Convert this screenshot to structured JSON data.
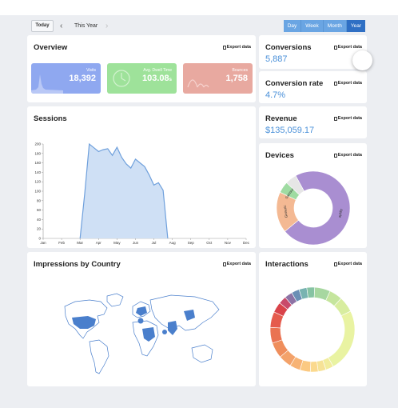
{
  "toolbar": {
    "today_label": "Today",
    "prev_icon": "chevron-left-icon",
    "period_label": "This Year",
    "next_icon": "chevron-right-icon",
    "range_options": [
      "Day",
      "Week",
      "Month",
      "Year"
    ],
    "active_range": "Year"
  },
  "export_label": "Export data",
  "overview": {
    "title": "Overview",
    "tiles": [
      {
        "label": "Visits",
        "value": "18,392",
        "color": "#8fa8f0",
        "icon": "area-sparkline-icon"
      },
      {
        "label": "Avg. Dwell Time",
        "value": "103.08",
        "suffix": "s",
        "color": "#9ee29a",
        "icon": "clock-icon"
      },
      {
        "label": "Bounces",
        "value": "1,758",
        "color": "#e8a9a0",
        "icon": "bounce-arc-icon"
      }
    ]
  },
  "conversions": {
    "title": "Conversions",
    "value": "5,887"
  },
  "conversion_rate": {
    "title": "Conversion rate",
    "value": "4.7%"
  },
  "revenue": {
    "title": "Revenue",
    "value": "$135,059.17"
  },
  "sessions": {
    "title": "Sessions"
  },
  "devices": {
    "title": "Devices"
  },
  "impressions": {
    "title": "Impressions by Country"
  },
  "interactions": {
    "title": "Interactions"
  },
  "chart_data": [
    {
      "type": "area",
      "title": "Sessions",
      "categories": [
        "Jan",
        "Feb",
        "Mar",
        "Apr",
        "May",
        "Jun",
        "Jul",
        "Aug",
        "Sep",
        "Oct",
        "Nov",
        "Dec"
      ],
      "x": [
        2.0,
        2.25,
        2.5,
        2.75,
        3.0,
        3.25,
        3.5,
        3.75,
        4.0,
        4.25,
        4.5,
        4.75,
        5.0,
        5.25,
        5.5,
        5.75,
        6.0,
        6.25,
        6.5,
        6.75
      ],
      "values": [
        0,
        95,
        200,
        192,
        184,
        188,
        190,
        176,
        193,
        172,
        158,
        149,
        168,
        160,
        152,
        134,
        113,
        118,
        102,
        0
      ],
      "ylim": [
        0,
        200
      ],
      "yticks": [
        0,
        20,
        40,
        60,
        80,
        100,
        120,
        140,
        160,
        180,
        200
      ],
      "color": "#6fa0dc",
      "fill": "#cfe0f5"
    },
    {
      "type": "pie",
      "title": "Devices",
      "donut": true,
      "series": [
        {
          "name": "Apple",
          "value": 72,
          "color": "#a98ed1"
        },
        {
          "name": "Generic",
          "value": 18,
          "color": "#f4b993"
        },
        {
          "name": "Samsung",
          "value": 5,
          "color": "#9fdba2"
        },
        {
          "name": "",
          "value": 5,
          "color": "#e6e6e6"
        }
      ]
    },
    {
      "type": "pie",
      "title": "Interactions",
      "donut": true,
      "series": [
        {
          "name": "",
          "value": 24,
          "color": "#e9f3a2"
        },
        {
          "name": "",
          "value": 3,
          "color": "#f2ec9c"
        },
        {
          "name": "",
          "value": 3,
          "color": "#f6e296"
        },
        {
          "name": "",
          "value": 3,
          "color": "#fbd98e"
        },
        {
          "name": "",
          "value": 4,
          "color": "#fbc982"
        },
        {
          "name": "",
          "value": 4,
          "color": "#f7b375"
        },
        {
          "name": "",
          "value": 5,
          "color": "#f3a26a"
        },
        {
          "name": "",
          "value": 6,
          "color": "#ef8e5c"
        },
        {
          "name": "",
          "value": 6,
          "color": "#ea7352"
        },
        {
          "name": "",
          "value": 6,
          "color": "#e55b4d"
        },
        {
          "name": "",
          "value": 4,
          "color": "#d9434a"
        },
        {
          "name": "",
          "value": 3,
          "color": "#c94a6a"
        },
        {
          "name": "",
          "value": 3,
          "color": "#8d73a5"
        },
        {
          "name": "",
          "value": 3,
          "color": "#6b8fb5"
        },
        {
          "name": "",
          "value": 3,
          "color": "#78b3b1"
        },
        {
          "name": "",
          "value": 3,
          "color": "#86c3a3"
        },
        {
          "name": "",
          "value": 6,
          "color": "#a7d7a0"
        },
        {
          "name": "",
          "value": 5,
          "color": "#c5e59d"
        },
        {
          "name": "",
          "value": 6,
          "color": "#d8ed9f"
        }
      ]
    }
  ],
  "map": {
    "base_color": "#ffffff",
    "stroke_color": "#4a7fcc",
    "highlight_color": "#4a7fcc"
  }
}
